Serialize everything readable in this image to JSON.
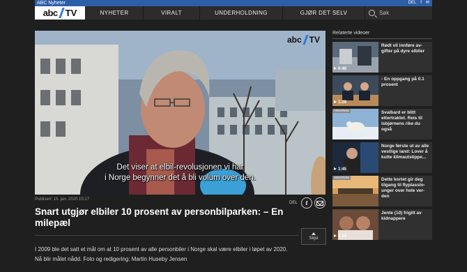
{
  "topbar": {
    "brand": "ABC Nyheter",
    "share_label": "DEL"
  },
  "nav": {
    "logo_abc": "abc",
    "logo_tv": "TV",
    "items": [
      "NYHETER",
      "VIRALT",
      "UNDERHOLDNING",
      "GJØR DET SELV"
    ],
    "search_placeholder": "Søk"
  },
  "video": {
    "logo_abc": "abc",
    "logo_tv": "TV",
    "subtitle_line1": "Det viser at elbil-revolusjonen vi har",
    "subtitle_line2": "i Norge begynner det å bli volum over den."
  },
  "article": {
    "published": "Publisert: 15. jan. 2020 15:17",
    "share_label": "DEL",
    "headline": "Snart utgjør elbiler 10 prosent av personbilparken: – En milepæl",
    "hide_label": "Skjul",
    "body": "I 2009 ble det satt et mål om at 10 prosent av alle personbiler i Norge skal være elbiler i løpet av 2020. Nå blir målet nådd. Foto og redigering: Martin Huseby Jensen"
  },
  "sidebar": {
    "heading": "Relaterte videoer",
    "items": [
      {
        "title": "Rødt vil innføre av-gifter på dyre elbiler",
        "duration": "0:40",
        "badge": ""
      },
      {
        "title": "- En oppgang på 0.1 prosent",
        "duration": "1:29",
        "badge": ""
      },
      {
        "title": "Svalbard er blitt ettertraktet. Reis til isbjørnens rike du også",
        "duration": "",
        "badge": "ANNONSE"
      },
      {
        "title": "Norge første ut av alle vestlige land: Lover å kutte klimautslippe...",
        "duration": "1:45",
        "badge": ""
      },
      {
        "title": "Dette kortet gir deg tilgang til flyplasslo-unger over hele ver-den",
        "duration": "",
        "badge": "ANNONSE"
      },
      {
        "title": "Jente (10) frigitt av kidnappere",
        "duration": "1:24",
        "badge": ""
      }
    ]
  },
  "colors": {
    "topstrip": "#2d5ea8",
    "nav_bg": "#2c2c2c",
    "page_bg": "#1f1f1f",
    "logo_slash": "#2d7bd6"
  }
}
